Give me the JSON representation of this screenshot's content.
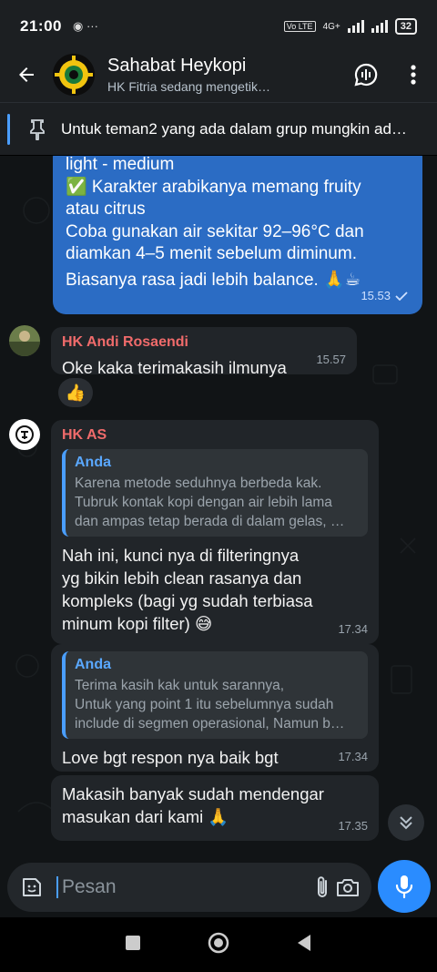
{
  "status": {
    "time": "21:00",
    "left_icons": "◉ ···",
    "network": "4G+",
    "volte": "Vo LTE",
    "battery": "32"
  },
  "header": {
    "title": "Sahabat Heykopi",
    "subtitle": "HK Fitria sedang mengetik…"
  },
  "pinned": {
    "text": "Untuk teman2 yang ada dalam grup mungkin ad…"
  },
  "messages": {
    "outgoing": {
      "lines": [
        "light - medium",
        "✅ Karakter arabikanya memang fruity",
        "atau citrus",
        "Coba gunakan air sekitar 92–96°C dan",
        "diamkan 4–5 menit sebelum diminum.",
        "Biasanya rasa jadi lebih balance. 🙏☕"
      ],
      "time": "15.53"
    },
    "andi": {
      "sender": "HK Andi Rosaendi",
      "text": "Oke kaka terimakasih ilmunya",
      "time": "15.57",
      "reaction": "👍"
    },
    "as1": {
      "sender": "HK AS",
      "quote_name": "Anda",
      "quote_lines": [
        "Karena metode seduhnya berbeda kak.",
        "Tubruk kontak kopi dengan air lebih lama",
        "dan ampas tetap berada di dalam gelas, …"
      ],
      "lines": [
        "Nah ini, kunci nya di filteringnya",
        "yg bikin lebih clean rasanya dan",
        "kompleks (bagi yg sudah terbiasa",
        "minum kopi filter) 😅"
      ],
      "time": "17.34"
    },
    "as2": {
      "quote_name": "Anda",
      "quote_lines": [
        "Terima kasih kak untuk sarannya,",
        "Untuk yang point 1 itu sebelumnya sudah",
        "include di segmen operasional, Namun b…"
      ],
      "text": "Love bgt respon nya baik bgt",
      "time": "17.34"
    },
    "as3": {
      "lines": [
        "Makasih banyak sudah mendengar",
        "masukan dari kami 🙏"
      ],
      "time": "17.35"
    }
  },
  "input": {
    "placeholder": "Pesan"
  },
  "colors": {
    "outgoing_bubble": "#2b6cc4",
    "incoming_bubble": "#212529",
    "sender_name": "#f06b6b",
    "accent": "#2a8cff"
  }
}
